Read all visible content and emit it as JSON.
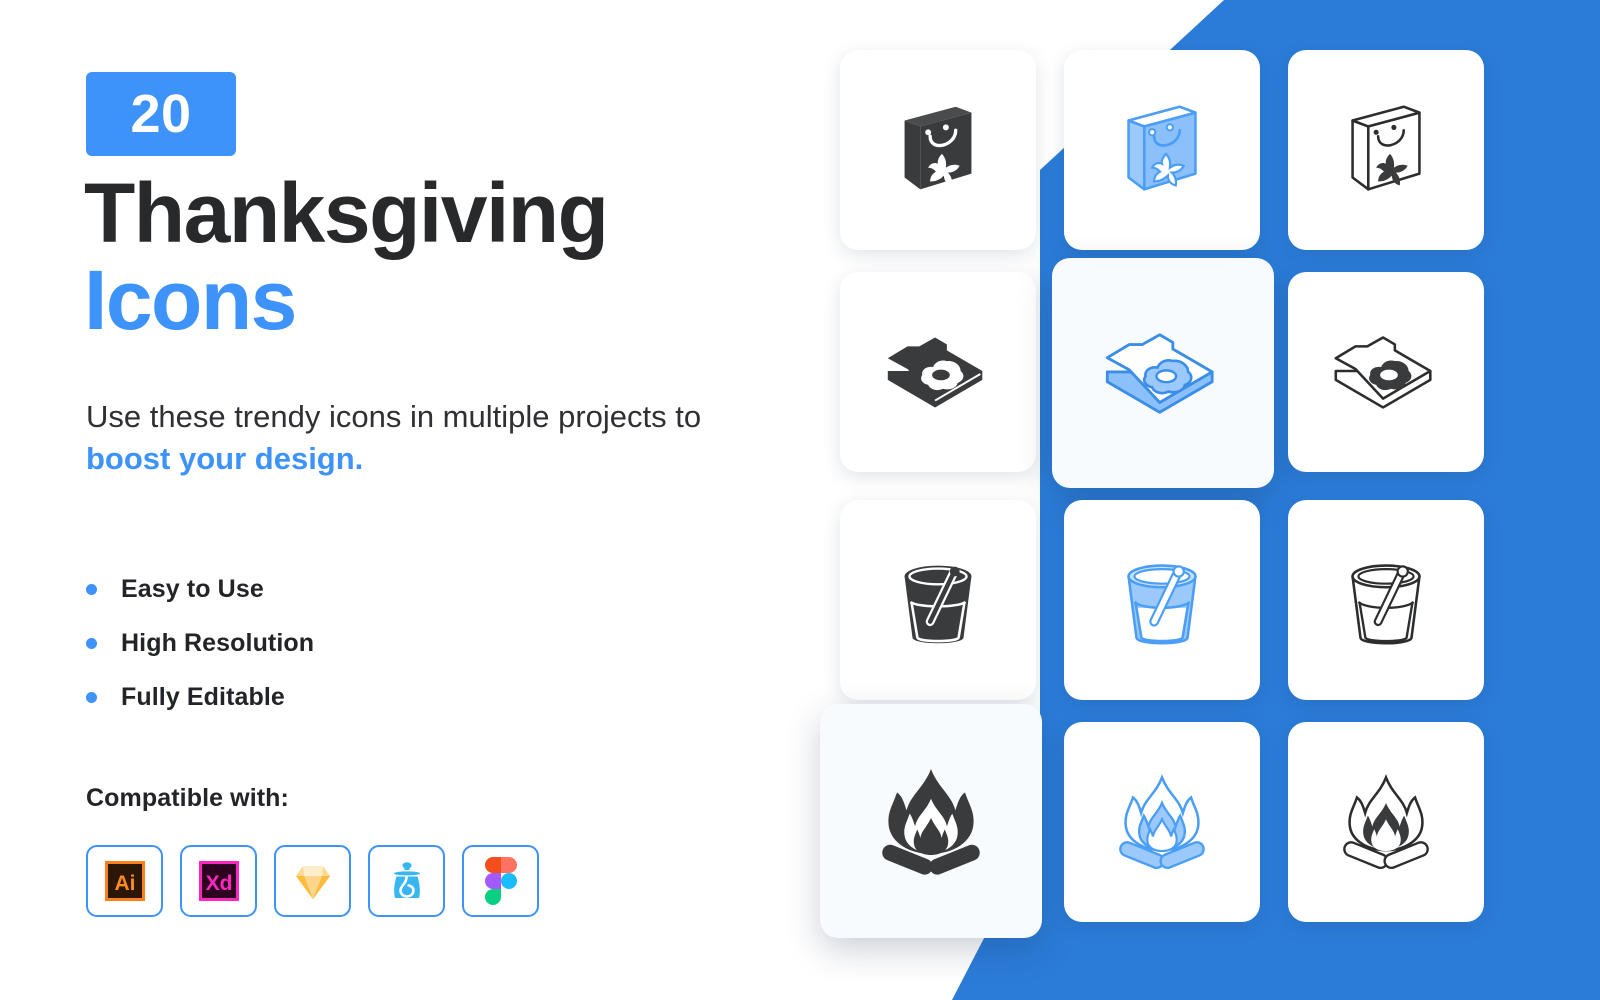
{
  "brand": {
    "accent_blue": "#3d93fa",
    "deep_blue": "#2b7cd8",
    "dark": "#28292b"
  },
  "left_panel": {
    "badge": {
      "count": "20"
    },
    "title": {
      "line1": "Thanksgiving",
      "line2": "Icons"
    },
    "subtitle": {
      "text_before": "Use these trendy icons in multiple projects to ",
      "highlight": "boost your design."
    },
    "features": [
      {
        "label": "Easy to Use"
      },
      {
        "label": "High Resolution"
      },
      {
        "label": "Fully Editable"
      }
    ],
    "compatible": {
      "heading": "Compatible with:",
      "apps": [
        {
          "name": "Adobe Illustrator",
          "icon": "adobe-illustrator-icon",
          "short": "Ai"
        },
        {
          "name": "Adobe XD",
          "icon": "adobe-xd-icon",
          "short": "Xd"
        },
        {
          "name": "Sketch",
          "icon": "sketch-icon",
          "short": ""
        },
        {
          "name": "InVision",
          "icon": "invision-icon",
          "short": ""
        },
        {
          "name": "Figma",
          "icon": "figma-icon",
          "short": ""
        }
      ]
    }
  },
  "right_panel": {
    "grid": {
      "rows": 4,
      "columns": 3,
      "styles": [
        "solid",
        "color",
        "outline"
      ],
      "cards": [
        {
          "icon": "shopping-bag-icon",
          "style": "solid",
          "row": 1,
          "col": 1,
          "elevated": false
        },
        {
          "icon": "shopping-bag-icon",
          "style": "color",
          "row": 1,
          "col": 2,
          "elevated": false
        },
        {
          "icon": "shopping-bag-icon",
          "style": "outline",
          "row": 1,
          "col": 3,
          "elevated": false
        },
        {
          "icon": "frying-pan-egg-icon",
          "style": "solid",
          "row": 2,
          "col": 1,
          "elevated": false
        },
        {
          "icon": "frying-pan-egg-icon",
          "style": "color",
          "row": 2,
          "col": 2,
          "elevated": true
        },
        {
          "icon": "frying-pan-egg-icon",
          "style": "outline",
          "row": 2,
          "col": 3,
          "elevated": false
        },
        {
          "icon": "cooking-pot-icon",
          "style": "solid",
          "row": 3,
          "col": 1,
          "elevated": false
        },
        {
          "icon": "cooking-pot-icon",
          "style": "color",
          "row": 3,
          "col": 2,
          "elevated": false
        },
        {
          "icon": "cooking-pot-icon",
          "style": "outline",
          "row": 3,
          "col": 3,
          "elevated": false
        },
        {
          "icon": "campfire-icon",
          "style": "solid",
          "row": 4,
          "col": 1,
          "elevated": true
        },
        {
          "icon": "campfire-icon",
          "style": "color",
          "row": 4,
          "col": 2,
          "elevated": false
        },
        {
          "icon": "campfire-icon",
          "style": "outline",
          "row": 4,
          "col": 3,
          "elevated": false
        }
      ]
    }
  }
}
